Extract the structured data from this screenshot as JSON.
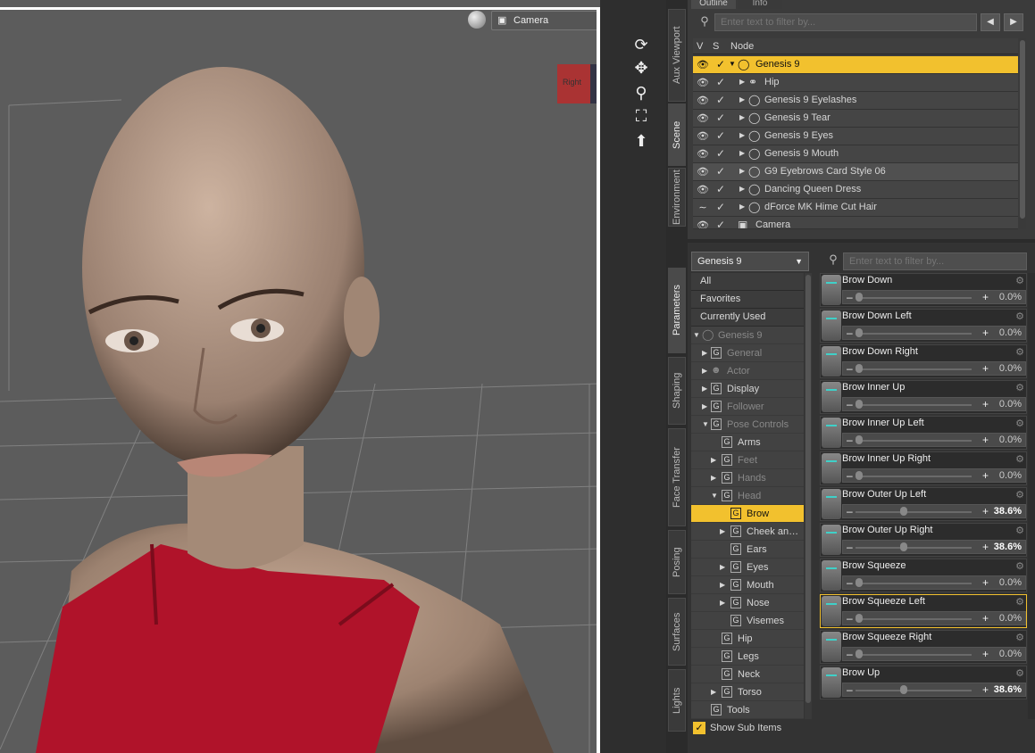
{
  "viewport": {
    "camera_label": "Camera",
    "cube_label": "Right"
  },
  "side_tabs_top": [
    "Aux Viewport",
    "Scene",
    "Environment"
  ],
  "side_tabs_bottom": [
    "Parameters",
    "Shaping",
    "Face Transfer",
    "Posing",
    "Surfaces",
    "Lights"
  ],
  "scene": {
    "tabs": [
      "Outline",
      "Info"
    ],
    "filter_placeholder": "Enter text to filter by...",
    "col_v": "V",
    "col_s": "S",
    "col_node": "Node",
    "nodes": [
      {
        "label": "Genesis 9",
        "selected": true,
        "expanded": true
      },
      {
        "label": "Hip"
      },
      {
        "label": "Genesis 9 Eyelashes"
      },
      {
        "label": "Genesis 9 Tear"
      },
      {
        "label": "Genesis 9 Eyes"
      },
      {
        "label": "Genesis 9 Mouth"
      },
      {
        "label": "G9 Eyebrows Card Style 06"
      },
      {
        "label": "Dancing Queen Dress"
      },
      {
        "label": "dForce MK Hime Cut Hair"
      },
      {
        "label": "Camera"
      }
    ]
  },
  "params": {
    "node_select": "Genesis 9",
    "filter_placeholder": "Enter text to filter by...",
    "presets": [
      "All",
      "Favorites",
      "Currently Used"
    ],
    "tree": [
      {
        "label": "Genesis 9",
        "dim": true
      },
      {
        "label": "General",
        "dim": true
      },
      {
        "label": "Actor",
        "dim": true
      },
      {
        "label": "Display"
      },
      {
        "label": "Follower",
        "dim": true
      },
      {
        "label": "Pose Controls",
        "dim": true
      },
      {
        "label": "Arms"
      },
      {
        "label": "Feet",
        "dim": true
      },
      {
        "label": "Hands",
        "dim": true
      },
      {
        "label": "Head",
        "dim": true
      },
      {
        "label": "Brow",
        "selected": true
      },
      {
        "label": "Cheek an…"
      },
      {
        "label": "Ears"
      },
      {
        "label": "Eyes"
      },
      {
        "label": "Mouth"
      },
      {
        "label": "Nose"
      },
      {
        "label": "Visemes"
      },
      {
        "label": "Hip"
      },
      {
        "label": "Legs"
      },
      {
        "label": "Neck"
      },
      {
        "label": "Torso"
      },
      {
        "label": "Tools"
      }
    ],
    "show_sub_items": "Show Sub Items",
    "sliders": [
      {
        "name": "Brow Down",
        "value": "0.0%",
        "level": 0
      },
      {
        "name": "Brow Down Left",
        "value": "0.0%",
        "level": 0
      },
      {
        "name": "Brow Down Right",
        "value": "0.0%",
        "level": 0
      },
      {
        "name": "Brow Inner Up",
        "value": "0.0%",
        "level": 0
      },
      {
        "name": "Brow Inner Up Left",
        "value": "0.0%",
        "level": 0
      },
      {
        "name": "Brow Inner Up Right",
        "value": "0.0%",
        "level": 0
      },
      {
        "name": "Brow Outer Up Left",
        "value": "38.6%",
        "level": 0.386
      },
      {
        "name": "Brow Outer Up Right",
        "value": "38.6%",
        "level": 0.386
      },
      {
        "name": "Brow Squeeze",
        "value": "0.0%",
        "level": 0
      },
      {
        "name": "Brow Squeeze Left",
        "value": "0.0%",
        "level": 0,
        "highlight": true
      },
      {
        "name": "Brow Squeeze Right",
        "value": "0.0%",
        "level": 0
      },
      {
        "name": "Brow Up",
        "value": "38.6%",
        "level": 0.386
      }
    ]
  }
}
